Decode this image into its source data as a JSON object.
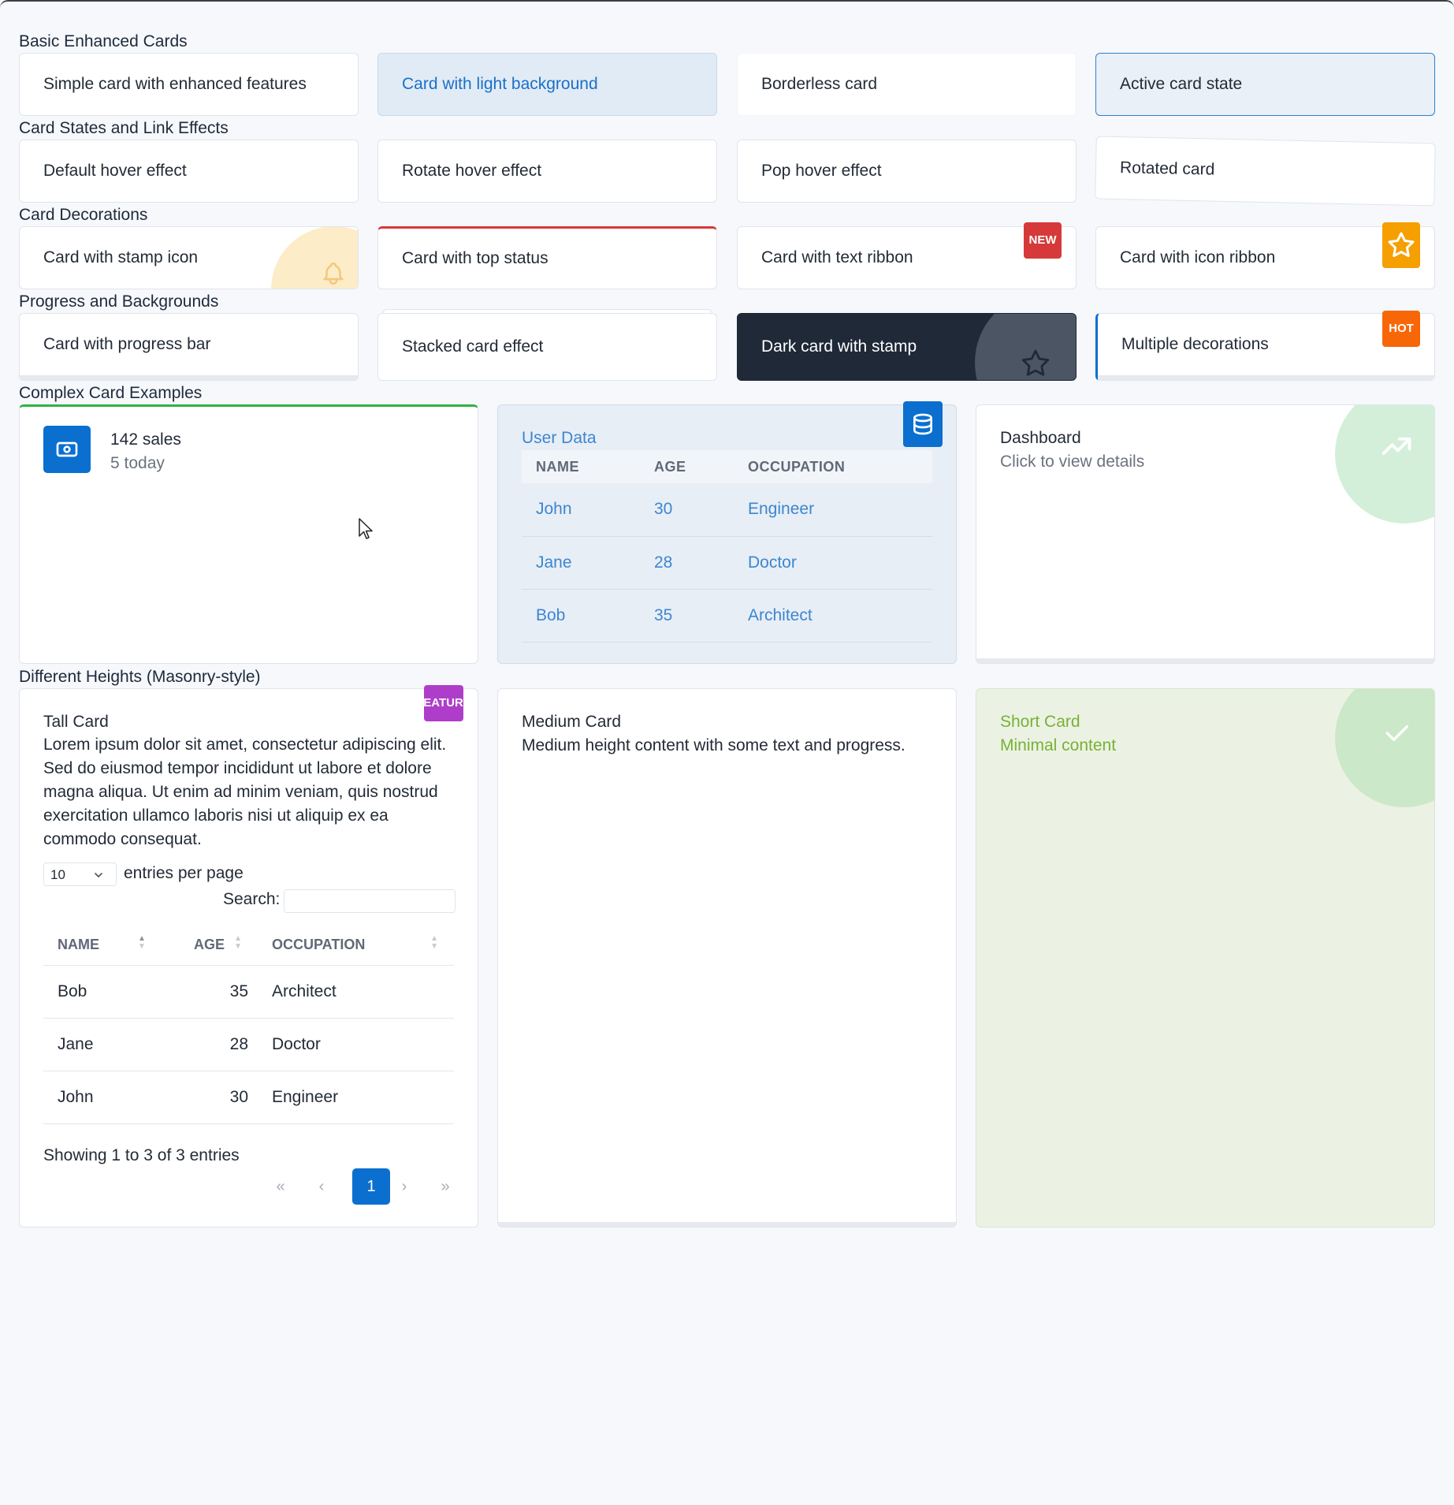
{
  "sections": {
    "basic": "Basic Enhanced Cards",
    "states": "Card States and Link Effects",
    "decorations": "Card Decorations",
    "progress": "Progress and Backgrounds",
    "complex": "Complex Card Examples",
    "heights": "Different Heights (Masonry-style)"
  },
  "basic_cards": [
    "Simple card with enhanced features",
    "Card with light background",
    "Borderless card",
    "Active card state"
  ],
  "state_cards": [
    "Default hover effect",
    "Rotate hover effect",
    "Pop hover effect",
    "Rotated card"
  ],
  "decoration_cards": [
    "Card with stamp icon",
    "Card with top status",
    "Card with text ribbon",
    "Card with icon ribbon"
  ],
  "ribbons": {
    "new": "NEW",
    "hot": "HOT",
    "feature": "FEATURE"
  },
  "progress_cards": [
    "Card with progress bar",
    "Stacked card effect",
    "Dark card with stamp",
    "Multiple decorations"
  ],
  "sales": {
    "title": "142 sales",
    "subtitle": "5 today"
  },
  "user_data": {
    "title": "User Data",
    "columns": [
      "NAME",
      "AGE",
      "OCCUPATION"
    ],
    "rows": [
      [
        "John",
        "30",
        "Engineer"
      ],
      [
        "Jane",
        "28",
        "Doctor"
      ],
      [
        "Bob",
        "35",
        "Architect"
      ]
    ]
  },
  "dashboard": {
    "title": "Dashboard",
    "subtitle": "Click to view details"
  },
  "tall_card": {
    "title": "Tall Card",
    "body": "Lorem ipsum dolor sit amet, consectetur adipiscing elit. Sed do eiusmod tempor incididunt ut labore et dolore magna aliqua. Ut enim ad minim veniam, quis nostrud exercitation ullamco laboris nisi ut aliquip ex ea commodo consequat.",
    "page_size": "10",
    "entries_label": "entries per page",
    "search_label": "Search:",
    "search_value": "",
    "columns": [
      "NAME",
      "AGE",
      "OCCUPATION"
    ],
    "rows": [
      [
        "Bob",
        "35",
        "Architect"
      ],
      [
        "Jane",
        "28",
        "Doctor"
      ],
      [
        "John",
        "30",
        "Engineer"
      ]
    ],
    "info": "Showing 1 to 3 of 3 entries",
    "pager": [
      "«",
      "‹",
      "1",
      "›",
      "»"
    ]
  },
  "medium_card": {
    "title": "Medium Card",
    "body": "Medium height content with some text and progress."
  },
  "short_card": {
    "title": "Short Card",
    "body": "Minimal content"
  },
  "colors": {
    "primary": "#0b6fd0",
    "danger": "#d63939",
    "warning": "#f59f00",
    "orange": "#f76707",
    "purple": "#ae3ec9",
    "success": "#2fb344",
    "dark": "#1f2937"
  },
  "icons": {
    "stamp": "bell-icon",
    "icon_ribbon": "star-icon",
    "dark_stamp": "star-icon",
    "sales": "cash-icon",
    "user_data": "database-icon",
    "dashboard": "trending-up-icon",
    "short": "check-icon"
  }
}
